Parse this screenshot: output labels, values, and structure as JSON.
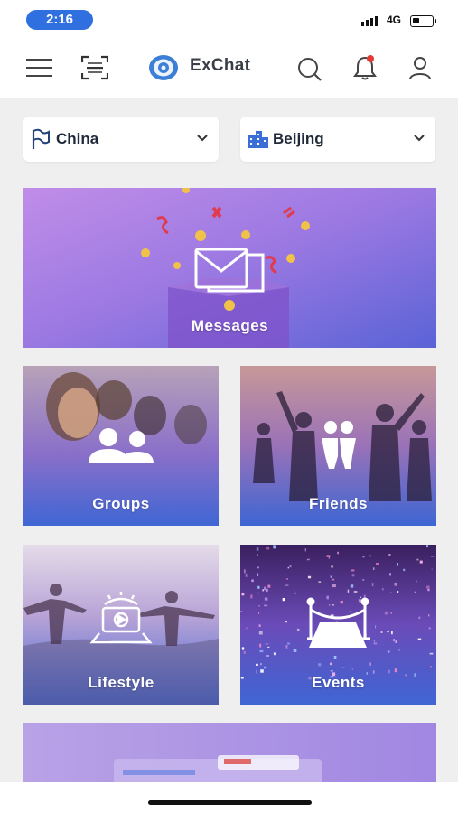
{
  "status_bar": {
    "time": "2:16",
    "network": "4G",
    "battery_level": 0.35
  },
  "header": {
    "title": "ExChat",
    "icons": [
      "menu-icon",
      "scan-icon",
      "exchat-logo",
      "search-icon",
      "bell-icon",
      "user-icon"
    ],
    "notification_dot_color": "#e53935"
  },
  "filters": {
    "country": {
      "value": "China",
      "icon": "flag-icon"
    },
    "city": {
      "value": "Beijing",
      "icon": "city-icon"
    }
  },
  "tiles": {
    "messages": "Messages",
    "groups": "Groups",
    "friends": "Friends",
    "lifestyle": "Lifestyle",
    "events": "Events"
  },
  "colors": {
    "accent": "#2f6fe0",
    "tile_purple": "#9b6fe0",
    "tile_blue": "#3b6fd8"
  }
}
